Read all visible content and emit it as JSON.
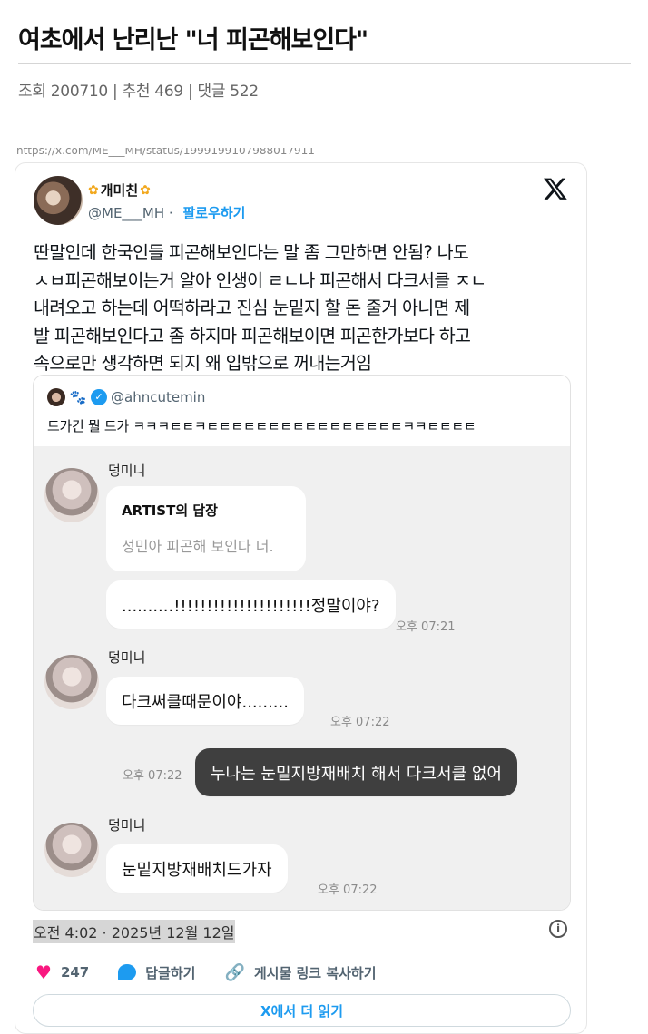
{
  "post": {
    "title": "여초에서 난리난 \"너 피곤해보인다\"",
    "meta": "조회 200710 | 추천 469 | 댓글 522",
    "url_fragment": "https://x.com/ME___MH/status/1999199107988017911"
  },
  "tweet": {
    "display_name": "개미친",
    "handle": "@ME___MH",
    "follow_label": "팔로우하기",
    "text_lines": [
      "딴말인데 한국인들 피곤해보인다는 말 좀 그만하면 안됨? 나도",
      "ㅅㅂ피곤해보이는거 알아 인생이 ㄹㄴ나 피곤해서 다크서클 ㅈㄴ",
      "내려오고 하는데 어떡하라고 진심 눈밑지 할 돈 줄거 아니면 제",
      "발 피곤해보인다고 좀 하지마 피곤해보이면 피곤한가보다 하고",
      "속으로만 생각하면 되지 왜 입밖으로 꺼내는거임"
    ],
    "date": "오전 4:02 · 2025년 12월 12일",
    "likes": "247",
    "reply_label": "답글하기",
    "copy_link_label": "게시물 링크 복사하기",
    "read_more_label": "X에서 더 읽기"
  },
  "quote": {
    "handle": "@ahncutemin",
    "text": "드가긴 뭘 드가 ㅋㅋㅋㅌㅌㅋㅌㅌㅌㅌㅌㅌㅌㅌㅌㅌㅌㅌㅌㅌㅌㅌㅋㅋㅌㅌㅌㅌ"
  },
  "chat": {
    "name": "덩미니",
    "artist_title": "ARTIST의 답장",
    "artist_sub": "성민아 피곤해 보인다 너.",
    "msg1": "..........!!!!!!!!!!!!!!!!!!!!!정말이야?",
    "time1": "오후 07:21",
    "msg2": "다크써클때문이야.........",
    "time2": "오후 07:22",
    "msg3": "누나는 눈밑지방재배치 해서 다크서클 없어",
    "time3": "오후 07:22",
    "msg4": "눈밑지방재배치드가자",
    "time4": "오후 07:22"
  },
  "colors": {
    "accent": "#1d9bf0",
    "like": "#f91880",
    "dark_bubble": "#3f3f3f",
    "chat_bg": "#f0f0f0"
  },
  "icons": {
    "flower": "flower-icon",
    "x_logo": "x-logo-icon",
    "verified": "verified-badge-icon",
    "heart": "heart-icon",
    "reply": "reply-bubble-icon",
    "link": "link-icon",
    "info": "info-icon"
  }
}
